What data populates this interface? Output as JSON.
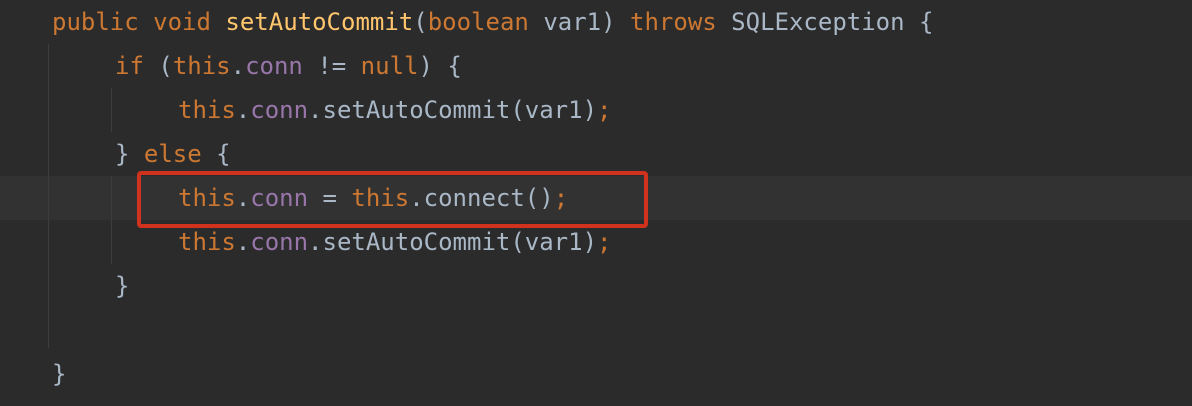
{
  "code": {
    "line1": {
      "kw_public": "public",
      "kw_void": "void",
      "method_name": "setAutoCommit",
      "paren_open": "(",
      "kw_boolean": "boolean",
      "param": "var1)",
      "kw_throws": "throws",
      "exception": "SQLException {"
    },
    "line2": {
      "kw_if": "if",
      "paren": "(",
      "kw_this": "this",
      "dot": ".",
      "field": "conn",
      "op": "!=",
      "kw_null": "null",
      "close": ") {"
    },
    "line3": {
      "kw_this": "this",
      "dot1": ".",
      "field": "conn",
      "call": ".setAutoCommit(var1)",
      "semi": ";"
    },
    "line4": {
      "brace": "}",
      "kw_else": "else",
      "open": "{"
    },
    "line5": {
      "kw_this": "this",
      "dot": ".",
      "field": "conn",
      "eq": "=",
      "kw_this2": "this",
      "call": ".connect()",
      "semi": ";"
    },
    "line6": {
      "kw_this": "this",
      "dot1": ".",
      "field": "conn",
      "call": ".setAutoCommit(var1)",
      "semi": ";"
    },
    "line7": {
      "brace": "}"
    },
    "line9": {
      "brace": "}"
    }
  },
  "colors": {
    "background": "#2b2b2b",
    "keyword": "#cc7832",
    "method": "#ffc66d",
    "field": "#9876aa",
    "text": "#a9b7c6",
    "highlight_border": "#d0321e"
  }
}
